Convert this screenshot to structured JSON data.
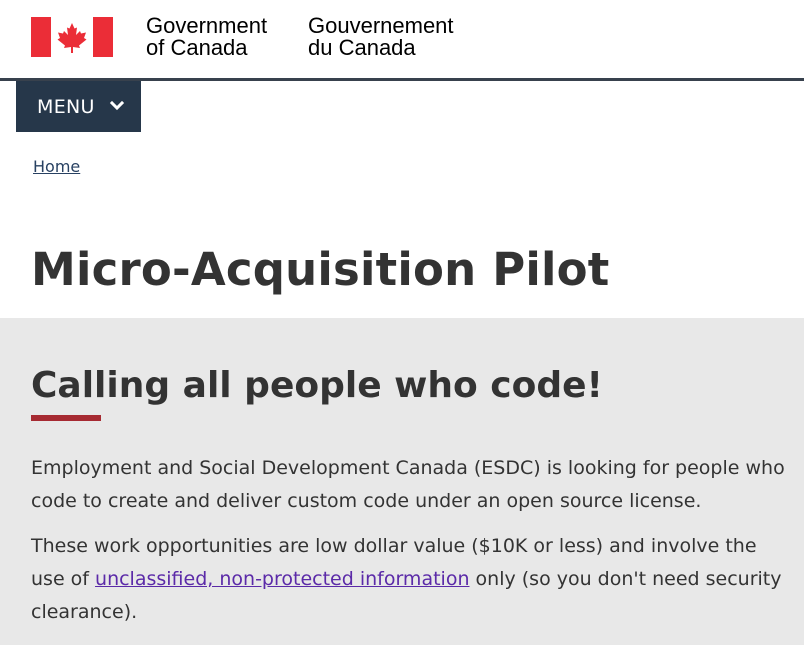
{
  "header": {
    "wordmark_en_line1": "Government",
    "wordmark_en_line2": "of Canada",
    "wordmark_fr_line1": "Gouvernement",
    "wordmark_fr_line2": "du Canada",
    "flag_icon": "canada-flag-icon"
  },
  "menu": {
    "label": "MENU",
    "icon": "chevron-down-icon"
  },
  "breadcrumb": {
    "home_label": "Home"
  },
  "page": {
    "title": "Micro-Acquisition Pilot"
  },
  "panel": {
    "heading": "Calling all people who code!",
    "paragraph1": "Employment and Social Development Canada (ESDC) is looking for people who code to create and deliver custom code under an open source license.",
    "paragraph2_before": "These work opportunities are low dollar value ($10K or less) and involve the use of ",
    "paragraph2_link": "unclassified, non-protected information",
    "paragraph2_after": " only (so you don't need security clearance)."
  },
  "colors": {
    "flag_red": "#eb2d37",
    "menu_bg": "#26374a",
    "panel_bg": "#e8e8e8",
    "accent_rule": "#a62a32",
    "link": "#5b2aa8"
  }
}
